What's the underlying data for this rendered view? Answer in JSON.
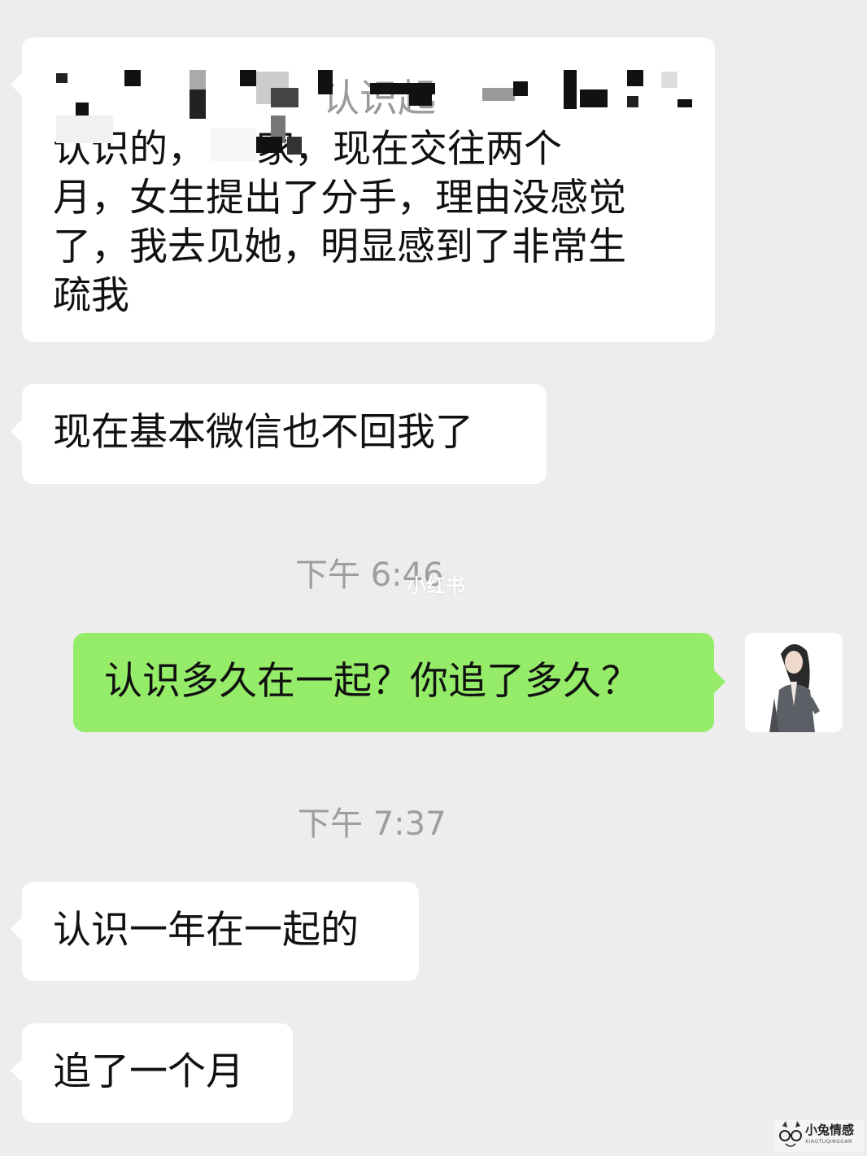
{
  "messages": [
    {
      "side": "in",
      "lines": [
        "",
        "认识的，   一家，现在交往两个",
        "月，女生提出了分手，理由没感觉",
        "了，我去见她，明显感到了非常生",
        "疏我"
      ],
      "redacted_line_1": "认识起"
    },
    {
      "side": "in",
      "lines": [
        "现在基本微信也不回我了"
      ]
    },
    {
      "side": "out",
      "lines": [
        "认识多久在一起？你追了多久？"
      ]
    },
    {
      "side": "in",
      "lines": [
        "认识一年在一起的"
      ]
    },
    {
      "side": "in",
      "lines": [
        "追了一个月"
      ]
    }
  ],
  "timestamps": [
    "下午 6:46",
    "下午 7:37"
  ],
  "watermark": "小红书",
  "logo": {
    "name": "小兔情感",
    "sub": "XIAOTUQINGGAN",
    "icon": "glasses-icon"
  },
  "colors": {
    "background": "#ededed",
    "incoming": "#ffffff",
    "outgoing": "#95ec69",
    "timestamp": "#9e9e9e"
  }
}
